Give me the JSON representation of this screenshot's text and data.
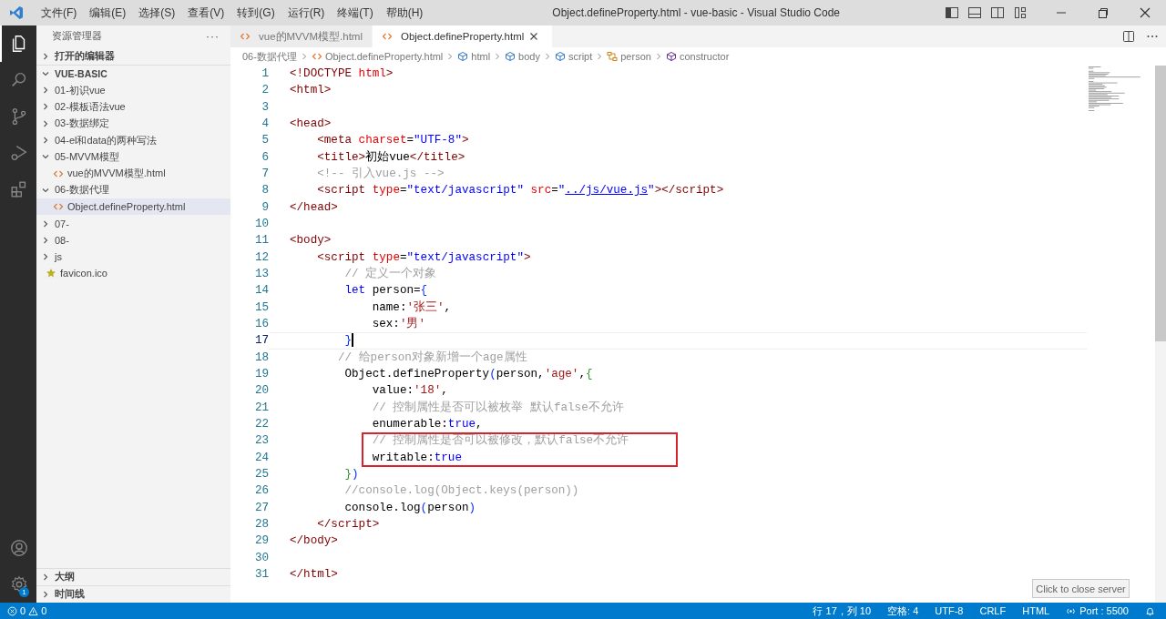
{
  "window": {
    "title": "Object.defineProperty.html - vue-basic - Visual Studio Code"
  },
  "menu": [
    "文件(F)",
    "编辑(E)",
    "选择(S)",
    "查看(V)",
    "转到(G)",
    "运行(R)",
    "终端(T)",
    "帮助(H)"
  ],
  "activity_bar": [
    {
      "kind": "files",
      "selected": true
    },
    {
      "kind": "search",
      "selected": false
    },
    {
      "kind": "scm",
      "selected": false
    },
    {
      "kind": "debug",
      "selected": false
    },
    {
      "kind": "extensions",
      "selected": false
    }
  ],
  "settings_badge": "1",
  "sidebar": {
    "title": "资源管理器",
    "more": "···",
    "sections": [
      {
        "label": "打开的编辑器",
        "expanded": false
      },
      {
        "label": "VUE-BASIC",
        "expanded": true
      }
    ],
    "items": [
      {
        "label": "01-初识vue",
        "kind": "folder",
        "expanded": false,
        "selected": false
      },
      {
        "label": "02-模板语法vue",
        "kind": "folder",
        "expanded": false,
        "selected": false
      },
      {
        "label": "03-数据绑定",
        "kind": "folder",
        "expanded": false,
        "selected": false
      },
      {
        "label": "04-el和data的两种写法",
        "kind": "folder",
        "expanded": false,
        "selected": false
      },
      {
        "label": "05-MVVM模型",
        "kind": "folder",
        "expanded": true,
        "selected": false,
        "children": [
          {
            "label": "vue的MVVM模型.html",
            "kind": "html",
            "selected": false
          }
        ]
      },
      {
        "label": "06-数据代理",
        "kind": "folder",
        "expanded": true,
        "selected": false,
        "children": [
          {
            "label": "Object.defineProperty.html",
            "kind": "html",
            "selected": true
          }
        ]
      },
      {
        "label": "07-",
        "kind": "folder",
        "expanded": false,
        "selected": false
      },
      {
        "label": "08-",
        "kind": "folder",
        "expanded": false,
        "selected": false
      },
      {
        "label": "js",
        "kind": "folder",
        "expanded": false,
        "selected": false
      },
      {
        "label": "favicon.ico",
        "kind": "favicon",
        "selected": false
      }
    ],
    "bottom_sections": [
      {
        "label": "大纲",
        "expanded": false
      },
      {
        "label": "时间线",
        "expanded": false
      }
    ]
  },
  "tabs": [
    {
      "label": "vue的MVVM模型.html",
      "selected": false
    },
    {
      "label": "Object.defineProperty.html",
      "selected": true
    }
  ],
  "breadcrumb": [
    {
      "label": "06-数据代理",
      "kind": "folder"
    },
    {
      "label": "Object.defineProperty.html",
      "kind": "file"
    },
    {
      "label": "html",
      "kind": "element"
    },
    {
      "label": "body",
      "kind": "element"
    },
    {
      "label": "script",
      "kind": "element"
    },
    {
      "label": "person",
      "kind": "variable"
    },
    {
      "label": "constructor",
      "kind": "method"
    }
  ],
  "code": [
    {
      "number": "1",
      "tokens": [
        {
          "kind": "tag",
          "text": "<!DOCTYPE "
        },
        {
          "kind": "attr",
          "text": "html"
        },
        {
          "kind": "tag",
          "text": ">"
        }
      ]
    },
    {
      "number": "2",
      "tokens": [
        {
          "kind": "tag",
          "text": "<html>"
        }
      ]
    },
    {
      "number": "3"
    },
    {
      "number": "4",
      "tokens": [
        {
          "kind": "tag",
          "text": "<head>"
        }
      ]
    },
    {
      "number": "5",
      "tokens": [
        {
          "kind": "tag",
          "text": "    <meta "
        },
        {
          "kind": "attr",
          "text": "charset"
        },
        {
          "kind": "plain",
          "text": "="
        },
        {
          "kind": "string",
          "text": "\"UTF-8\""
        },
        {
          "kind": "tag",
          "text": ">"
        }
      ]
    },
    {
      "number": "6",
      "tokens": [
        {
          "kind": "tag",
          "text": "    <title>"
        },
        {
          "kind": "plain",
          "text": "初始vue"
        },
        {
          "kind": "tag",
          "text": "</title>"
        }
      ]
    },
    {
      "number": "7",
      "tokens": [
        {
          "kind": "comment",
          "text": "    <!-- 引入vue.js -->"
        }
      ]
    },
    {
      "number": "8",
      "tokens": [
        {
          "kind": "tag",
          "text": "    <script "
        },
        {
          "kind": "attr",
          "text": "type"
        },
        {
          "kind": "plain",
          "text": "="
        },
        {
          "kind": "string",
          "text": "\"text/javascript\" "
        },
        {
          "kind": "attr",
          "text": "src"
        },
        {
          "kind": "plain",
          "text": "="
        },
        {
          "kind": "string",
          "text": "\""
        },
        {
          "kind": "link",
          "text": "../js/vue.js"
        },
        {
          "kind": "string",
          "text": "\""
        },
        {
          "kind": "tag",
          "text": "></script>"
        }
      ]
    },
    {
      "number": "9",
      "tokens": [
        {
          "kind": "tag",
          "text": "</head>"
        }
      ]
    },
    {
      "number": "10"
    },
    {
      "number": "11",
      "tokens": [
        {
          "kind": "tag",
          "text": "<body>"
        }
      ]
    },
    {
      "number": "12",
      "tokens": [
        {
          "kind": "tag",
          "text": "    <script "
        },
        {
          "kind": "attr",
          "text": "type"
        },
        {
          "kind": "plain",
          "text": "="
        },
        {
          "kind": "string",
          "text": "\"text/javascript\""
        },
        {
          "kind": "tag",
          "text": ">"
        }
      ]
    },
    {
      "number": "13",
      "tokens": [
        {
          "kind": "comment",
          "text": "        // 定义一个对象"
        }
      ]
    },
    {
      "number": "14",
      "tokens": [
        {
          "kind": "keyword",
          "text": "        let"
        },
        {
          "kind": "plain",
          "text": " person="
        },
        {
          "kind": "bracket",
          "text": "{"
        }
      ]
    },
    {
      "number": "15",
      "tokens": [
        {
          "kind": "plain",
          "text": "            name:"
        },
        {
          "kind": "jsstring",
          "text": "'张三'"
        },
        {
          "kind": "plain",
          "text": ","
        }
      ]
    },
    {
      "number": "16",
      "tokens": [
        {
          "kind": "plain",
          "text": "            sex:"
        },
        {
          "kind": "jsstring",
          "text": "'男'"
        }
      ]
    },
    {
      "number": "17",
      "selected": true,
      "tokens": [
        {
          "kind": "bracket",
          "text": "        }"
        }
      ]
    },
    {
      "number": "18",
      "tokens": [
        {
          "kind": "comment",
          "text": "       // 给person对象新增一个age属性"
        }
      ]
    },
    {
      "number": "19",
      "tokens": [
        {
          "kind": "plain",
          "text": "        Object.defineProperty"
        },
        {
          "kind": "bracket",
          "text": "("
        },
        {
          "kind": "plain",
          "text": "person,"
        },
        {
          "kind": "jsstring",
          "text": "'age'"
        },
        {
          "kind": "plain",
          "text": ","
        },
        {
          "kind": "bracket2",
          "text": "{"
        }
      ]
    },
    {
      "number": "20",
      "tokens": [
        {
          "kind": "plain",
          "text": "            value:"
        },
        {
          "kind": "jsstring",
          "text": "'18'"
        },
        {
          "kind": "plain",
          "text": ","
        }
      ]
    },
    {
      "number": "21",
      "tokens": [
        {
          "kind": "comment",
          "text": "            // 控制属性是否可以被枚举 默认false不允许"
        }
      ]
    },
    {
      "number": "22",
      "tokens": [
        {
          "kind": "plain",
          "text": "            enumerable:"
        },
        {
          "kind": "keyword",
          "text": "true"
        },
        {
          "kind": "plain",
          "text": ","
        }
      ]
    },
    {
      "number": "23",
      "boxed": true,
      "tokens": [
        {
          "kind": "comment",
          "text": "            // 控制属性是否可以被修改，默认false不允许"
        }
      ]
    },
    {
      "number": "24",
      "boxed": true,
      "tokens": [
        {
          "kind": "plain",
          "text": "            writable:"
        },
        {
          "kind": "keyword",
          "text": "true"
        }
      ]
    },
    {
      "number": "25",
      "tokens": [
        {
          "kind": "bracket2",
          "text": "        }"
        },
        {
          "kind": "bracket",
          "text": ")"
        }
      ]
    },
    {
      "number": "26",
      "tokens": [
        {
          "kind": "comment",
          "text": "        //console.log(Object.keys(person))"
        }
      ]
    },
    {
      "number": "27",
      "tokens": [
        {
          "kind": "plain",
          "text": "        console.log"
        },
        {
          "kind": "bracket",
          "text": "("
        },
        {
          "kind": "plain",
          "text": "person"
        },
        {
          "kind": "bracket",
          "text": ")"
        }
      ]
    },
    {
      "number": "28",
      "tokens": [
        {
          "kind": "tag",
          "text": "    </script>"
        }
      ]
    },
    {
      "number": "29",
      "tokens": [
        {
          "kind": "tag",
          "text": "</body>"
        }
      ]
    },
    {
      "number": "30"
    },
    {
      "number": "31",
      "tokens": [
        {
          "kind": "tag",
          "text": "</html>"
        }
      ]
    }
  ],
  "tooltip": "Click to close server",
  "status_bar": {
    "errors": "0",
    "warnings": "0",
    "items": [
      {
        "kind": "text",
        "label": "行 17，列 10"
      },
      {
        "kind": "text",
        "label": "空格: 4"
      },
      {
        "kind": "text",
        "label": "UTF-8"
      },
      {
        "kind": "text",
        "label": "CRLF"
      },
      {
        "kind": "text",
        "label": "HTML"
      },
      {
        "kind": "port",
        "label": "Port : 5500"
      },
      {
        "kind": "bell"
      }
    ]
  }
}
